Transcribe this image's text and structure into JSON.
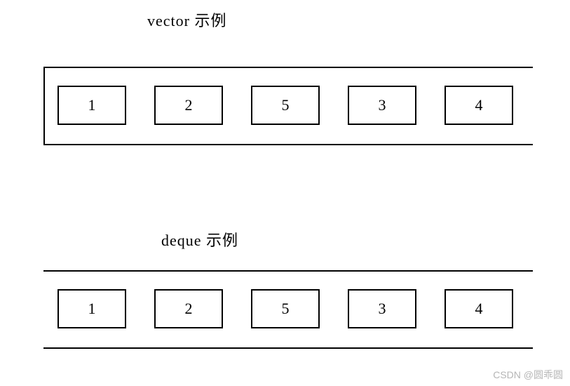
{
  "vector": {
    "title": "vector 示例",
    "cells": [
      "1",
      "2",
      "5",
      "3",
      "4"
    ]
  },
  "deque": {
    "title": "deque 示例",
    "cells": [
      "1",
      "2",
      "5",
      "3",
      "4"
    ]
  },
  "watermark": "CSDN @圆乖圆"
}
